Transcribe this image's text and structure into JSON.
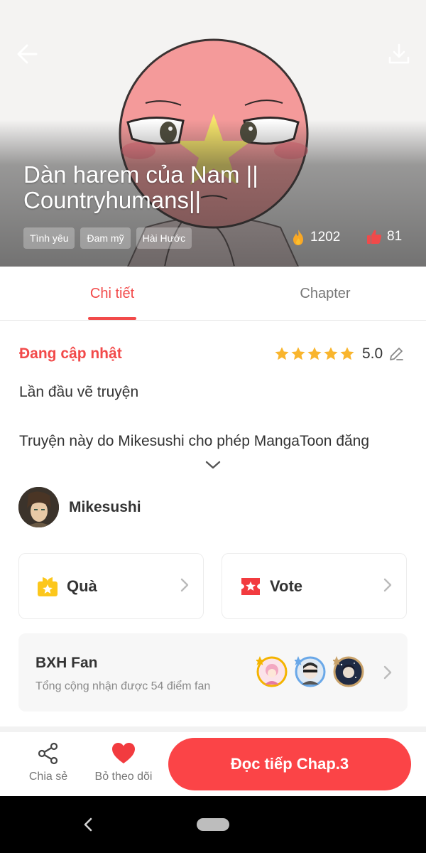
{
  "header": {
    "title": "Dàn harem của Nam || Countryhumans||",
    "tags": [
      "Tình yêu",
      "Đam mỹ",
      "Hài Hước"
    ],
    "views": "1202",
    "likes": "81",
    "icons": {
      "back": "arrow-left-icon",
      "download": "download-icon",
      "views": "fire-icon",
      "likes": "thumbs-up-icon"
    }
  },
  "tabs": [
    {
      "label": "Chi tiết",
      "active": true
    },
    {
      "label": "Chapter",
      "active": false
    }
  ],
  "detail": {
    "status": "Đang cập nhật",
    "rating": "5.0",
    "rating_stars": 5,
    "description_line1": "Lần đầu vẽ truyện",
    "description_line2": "Truyện này do Mikesushi cho phép MangaToon đăng"
  },
  "author": {
    "name": "Mikesushi"
  },
  "actions": {
    "gift_label": "Quà",
    "vote_label": "Vote"
  },
  "fan_ranking": {
    "title": "BXH Fan",
    "subtitle": "Tổng cộng nhận được 54 điểm fan",
    "fan_count": 3
  },
  "bottom_bar": {
    "share_label": "Chia sẻ",
    "unfollow_label": "Bỏ theo dõi",
    "read_label": "Đọc tiếp Chap.3"
  },
  "colors": {
    "accent": "#f24a4a",
    "button": "#fb4447",
    "star": "#f9b52d",
    "gift": "#fcc71c"
  }
}
